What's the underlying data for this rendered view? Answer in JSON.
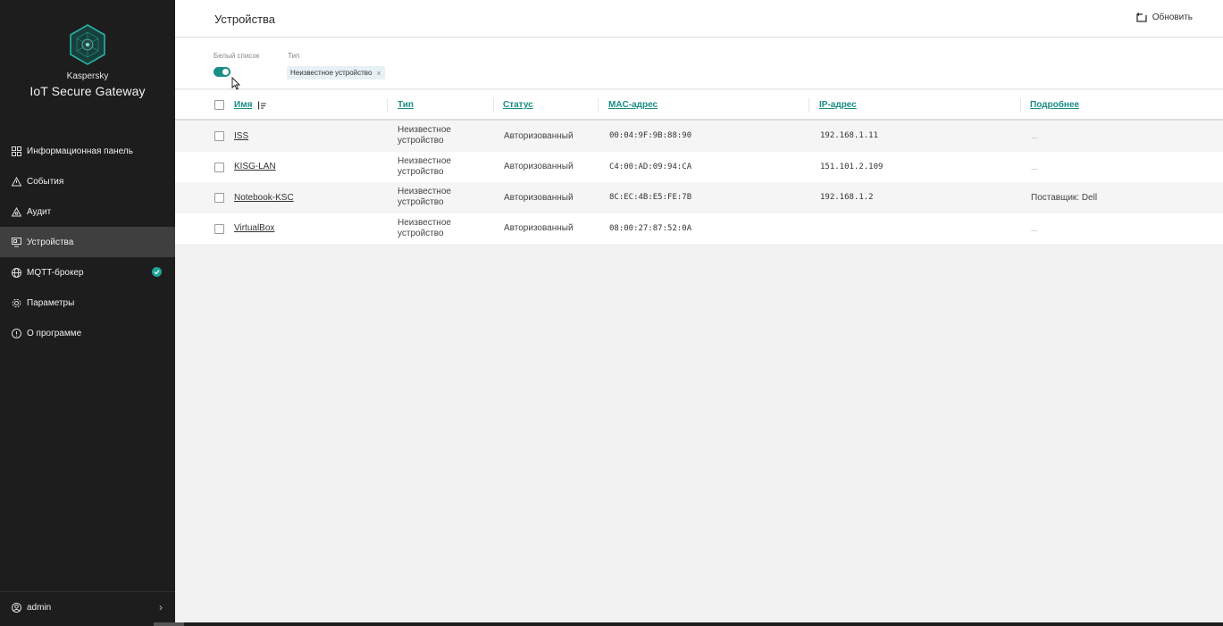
{
  "app": {
    "brand_small": "Kaspersky",
    "brand_name": "IoT Secure Gateway"
  },
  "sidebar": {
    "items": [
      {
        "label": "Информационная панель",
        "icon": "dashboard-icon"
      },
      {
        "label": "События",
        "icon": "warning-triangle-icon"
      },
      {
        "label": "Аудит",
        "icon": "audit-icon"
      },
      {
        "label": "Устройства",
        "icon": "devices-icon",
        "active": true
      },
      {
        "label": "MQTT-брокер",
        "icon": "globe-icon",
        "badge": "check-icon"
      },
      {
        "label": "Параметры",
        "icon": "gear-icon"
      },
      {
        "label": "О программе",
        "icon": "info-icon"
      }
    ],
    "user": "admin"
  },
  "header": {
    "title": "Устройства",
    "refresh_label": "Обновить"
  },
  "filters": {
    "whitelist_label": "Белый список",
    "whitelist_enabled": true,
    "type_label": "Тип",
    "type_chip": "Неизвестное устройство",
    "chip_remove": "×"
  },
  "table": {
    "columns": [
      "Имя",
      "Тип",
      "Статус",
      "MAC-адрес",
      "IP-адрес",
      "Подробнее"
    ],
    "rows": [
      {
        "name": "ISS",
        "type_line1": "Неизвестное",
        "type_line2": "устройство",
        "status": "Авторизованный",
        "mac": "00:04:9F:9B:88:90",
        "ip": "192.168.1.11",
        "details": "..."
      },
      {
        "name": "KISG-LAN",
        "type_line1": "Неизвестное",
        "type_line2": "устройство",
        "status": "Авторизованный",
        "mac": "C4:00:AD:09:94:CA",
        "ip": "151.101.2.109",
        "details": "..."
      },
      {
        "name": "Notebook-KSC",
        "type_line1": "Неизвестное",
        "type_line2": "устройство",
        "status": "Авторизованный",
        "mac": "8C:EC:4B:E5:FE:7B",
        "ip": "192.168.1.2",
        "details": "Поставщик: Dell"
      },
      {
        "name": "VirtualBox",
        "type_line1": "Неизвестное",
        "type_line2": "устройство",
        "status": "Авторизованный",
        "mac": "08:00:27:87:52:0A",
        "ip": "",
        "details": "..."
      }
    ]
  },
  "colors": {
    "accent": "#1a8d86",
    "sidebar_bg": "#1d1d1d",
    "sidebar_active": "#3f3f3f",
    "badge": "#1fa39a"
  }
}
